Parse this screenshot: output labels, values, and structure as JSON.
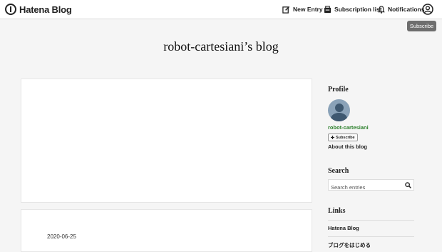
{
  "header": {
    "logo_text": "Hatena Blog",
    "nav": {
      "new_entry": "New Entry",
      "subscription_list": "Subscription list",
      "notifications": "Notifications"
    },
    "subscribe_label": "Subscribe"
  },
  "blog": {
    "title": "robot-cartesiani’s blog"
  },
  "entries": [
    {
      "date": "2020-06-25"
    }
  ],
  "sidebar": {
    "profile": {
      "heading": "Profile",
      "name": "robot-cartesiani",
      "subscribe_label": "Subscribe",
      "about_label": "About this blog"
    },
    "search": {
      "heading": "Search",
      "placeholder": "Search entries"
    },
    "links": {
      "heading": "Links",
      "items": [
        "Hatena Blog",
        "ブログをはじめる"
      ]
    }
  },
  "colors": {
    "profile_name": "#2a7f2a",
    "subscribe_button_bg": "#6e6e6e",
    "page_bg": "#f5f5f5"
  }
}
